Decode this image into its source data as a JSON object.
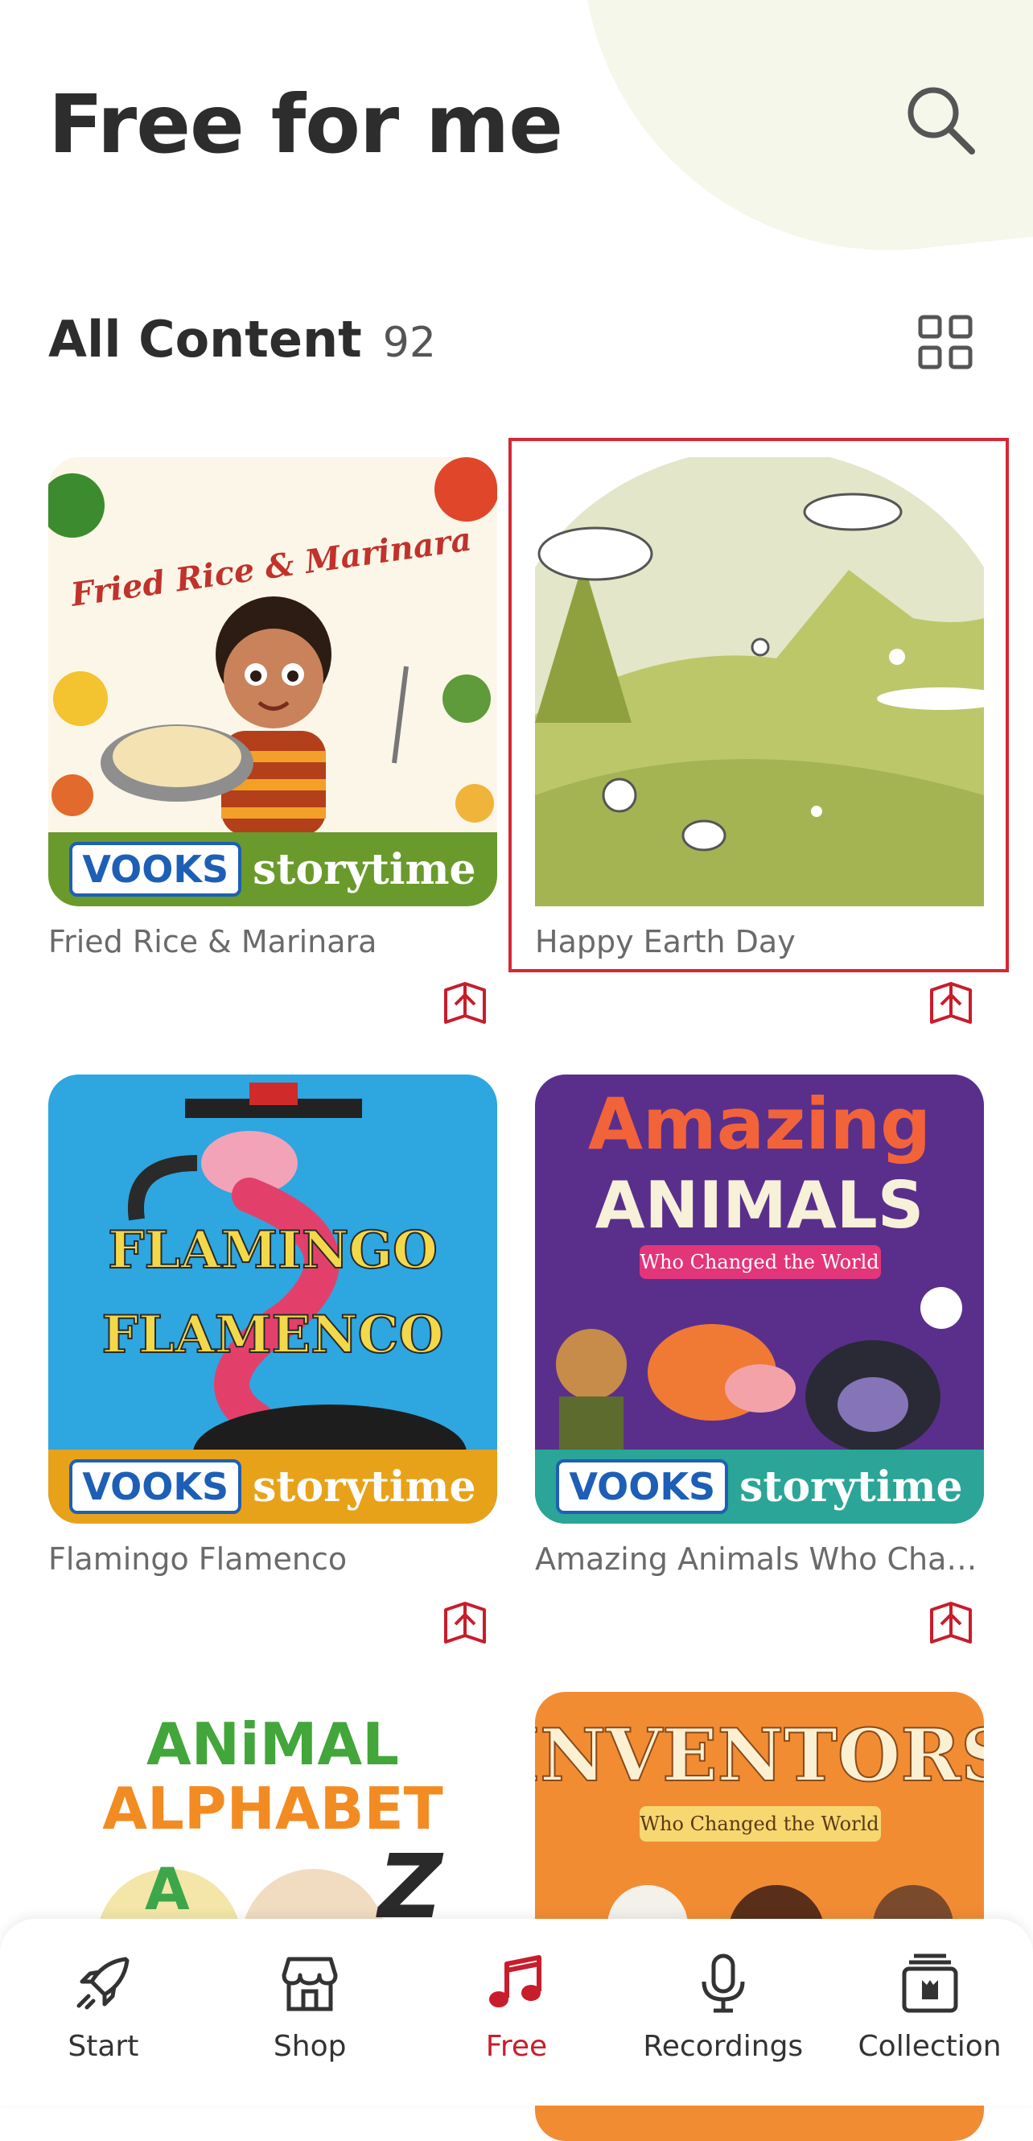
{
  "header": {
    "title": "Free for me",
    "search_icon": "search-icon"
  },
  "section": {
    "title": "All Content",
    "count": "92",
    "view_toggle_icon": "grid-view-icon"
  },
  "cards": [
    {
      "title": "Fried Rice & Marinara",
      "cover_text": "Fried Rice & Marinara",
      "badge_brand": "VOOKS",
      "badge_text": "storytime",
      "band_color": "#6a9a2c"
    },
    {
      "title": "Happy Earth Day"
    },
    {
      "title": "Flamingo Flamenco",
      "cover_line1": "FLAMINGO",
      "cover_line2": "FLAMENCO",
      "badge_brand": "VOOKS",
      "badge_text": "storytime",
      "band_color": "#e8a21a"
    },
    {
      "title": "Amazing Animals Who Chang...",
      "cover_line1": "Amazing",
      "cover_line2": "ANIMALS",
      "cover_subtitle": "Who Changed the World",
      "badge_brand": "VOOKS",
      "badge_text": "storytime",
      "band_color": "#2aa597"
    },
    {
      "title": "",
      "cover_line1": "ANiMAL",
      "cover_line2": "ALPHABET",
      "cover_letters": [
        "A",
        "Z"
      ]
    },
    {
      "title": "",
      "cover_line1": "INVENTORS",
      "cover_subtitle": "Who Changed the World"
    }
  ],
  "nav": [
    {
      "label": "Start",
      "icon": "rocket-icon"
    },
    {
      "label": "Shop",
      "icon": "store-icon"
    },
    {
      "label": "Free",
      "icon": "music-note-icon",
      "active": true
    },
    {
      "label": "Recordings",
      "icon": "microphone-icon"
    },
    {
      "label": "Collection",
      "icon": "collection-icon"
    }
  ],
  "colors": {
    "accent": "#c81d2b",
    "highlight": "#d62733"
  }
}
